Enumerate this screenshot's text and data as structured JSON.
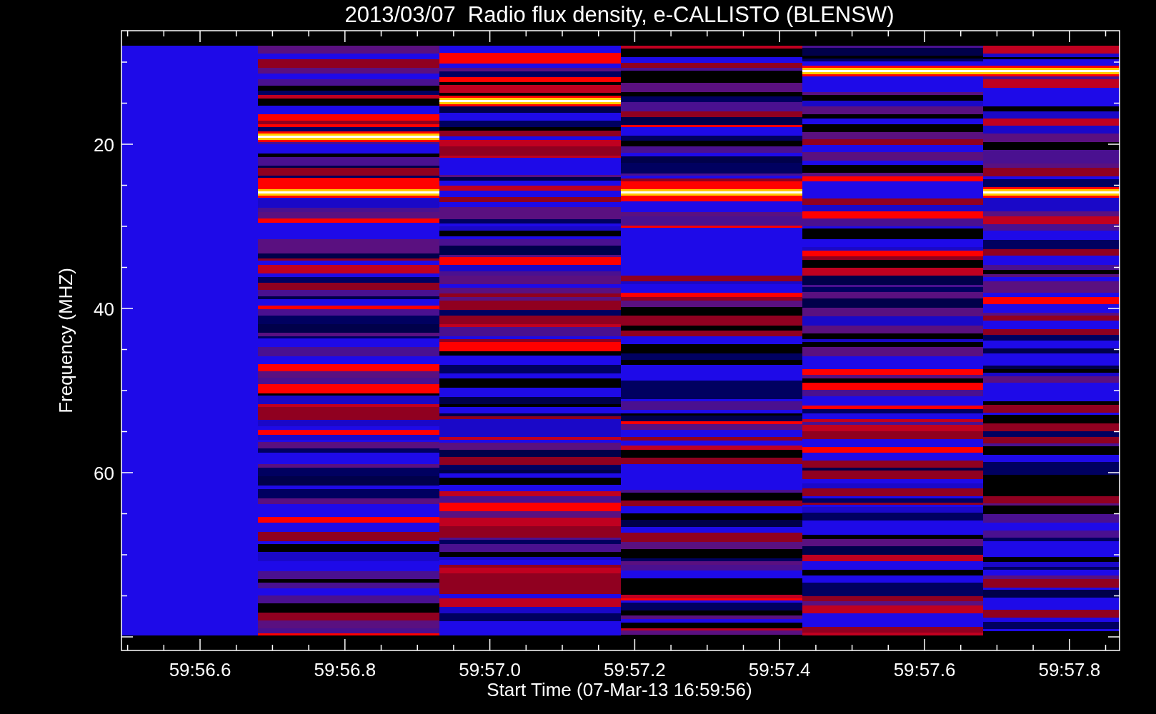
{
  "title": "2013/03/07  Radio flux density, e-CALLISTO (BLENSW)",
  "y_axis": {
    "label": "Frequency (MHZ)",
    "ticks": [
      "20",
      "40",
      "60"
    ]
  },
  "x_axis": {
    "label": "Start Time (07-Mar-13 16:59:56)",
    "ticks": [
      "59:56.6",
      "59:56.8",
      "59:57.0",
      "59:57.2",
      "59:57.4",
      "59:57.6",
      "59:57.8"
    ]
  }
}
